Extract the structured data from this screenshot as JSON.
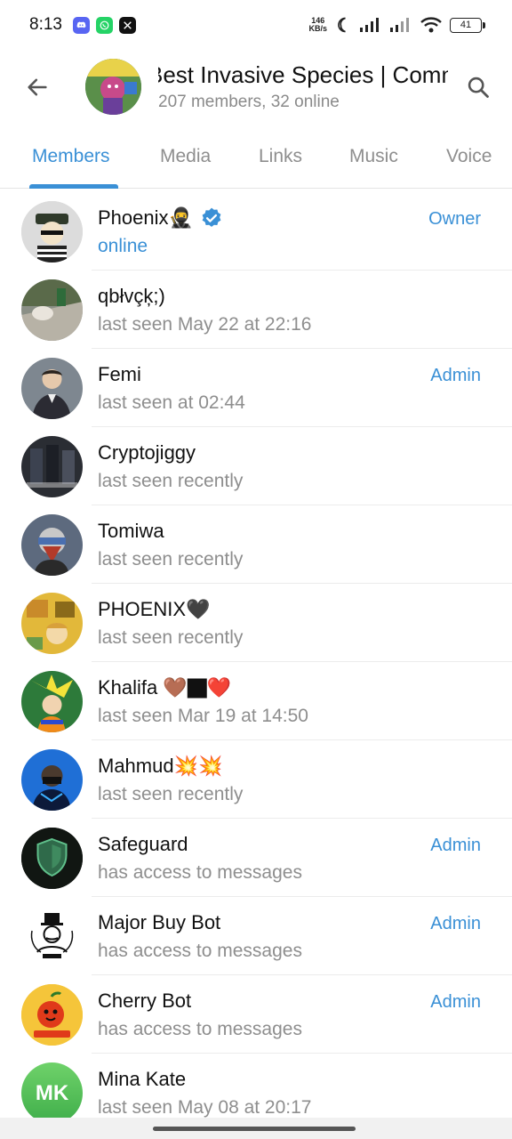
{
  "status_bar": {
    "time": "8:13",
    "net_speed_value": "146",
    "net_speed_unit": "KB/s",
    "battery": "41",
    "notifications": [
      "discord-icon",
      "whatsapp-icon",
      "x-icon"
    ]
  },
  "header": {
    "title": "Best Invasive Species | Comm",
    "subtitle": "207 members, 32 online"
  },
  "tabs": [
    {
      "label": "Members",
      "active": true
    },
    {
      "label": "Media",
      "active": false
    },
    {
      "label": "Links",
      "active": false
    },
    {
      "label": "Music",
      "active": false
    },
    {
      "label": "Voice",
      "active": false
    }
  ],
  "members": [
    {
      "name": "Phoenix🥷",
      "status": "online",
      "role": "Owner",
      "verified": true
    },
    {
      "name": "qbłvçķ;)",
      "status": "last seen May 22 at 22:16",
      "role": ""
    },
    {
      "name": "Femi",
      "status": "last seen at 02:44",
      "role": "Admin"
    },
    {
      "name": "Cryptojiggy",
      "status": "last seen recently",
      "role": ""
    },
    {
      "name": "Tomiwa",
      "status": "last seen recently",
      "role": ""
    },
    {
      "name": "PHOENIX🖤",
      "status": "last seen recently",
      "role": ""
    },
    {
      "name": "Khalifa 🤎🏿❤️",
      "status": "last seen Mar 19 at 14:50",
      "role": ""
    },
    {
      "name": "Mahmud💥💥",
      "status": "last seen recently",
      "role": ""
    },
    {
      "name": "Safeguard",
      "status": "has access to messages",
      "role": "Admin"
    },
    {
      "name": "Major Buy Bot",
      "status": "has access to messages",
      "role": "Admin"
    },
    {
      "name": "Cherry Bot",
      "status": "has access to messages",
      "role": "Admin"
    },
    {
      "name": "Mina Kate",
      "status": "last seen May 08 at 20:17",
      "role": "",
      "initials": "MK"
    }
  ],
  "colors": {
    "accent": "#3a90d6",
    "muted": "#8e8e8e"
  }
}
